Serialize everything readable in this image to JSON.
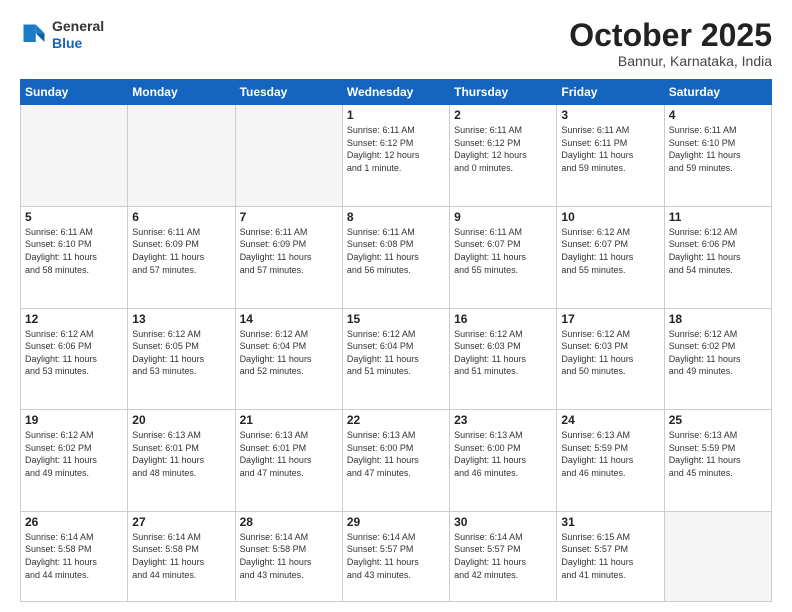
{
  "logo": {
    "line1": "General",
    "line2": "Blue"
  },
  "header": {
    "month": "October 2025",
    "location": "Bannur, Karnataka, India"
  },
  "days_of_week": [
    "Sunday",
    "Monday",
    "Tuesday",
    "Wednesday",
    "Thursday",
    "Friday",
    "Saturday"
  ],
  "weeks": [
    [
      {
        "day": "",
        "info": ""
      },
      {
        "day": "",
        "info": ""
      },
      {
        "day": "",
        "info": ""
      },
      {
        "day": "1",
        "info": "Sunrise: 6:11 AM\nSunset: 6:12 PM\nDaylight: 12 hours\nand 1 minute."
      },
      {
        "day": "2",
        "info": "Sunrise: 6:11 AM\nSunset: 6:12 PM\nDaylight: 12 hours\nand 0 minutes."
      },
      {
        "day": "3",
        "info": "Sunrise: 6:11 AM\nSunset: 6:11 PM\nDaylight: 11 hours\nand 59 minutes."
      },
      {
        "day": "4",
        "info": "Sunrise: 6:11 AM\nSunset: 6:10 PM\nDaylight: 11 hours\nand 59 minutes."
      }
    ],
    [
      {
        "day": "5",
        "info": "Sunrise: 6:11 AM\nSunset: 6:10 PM\nDaylight: 11 hours\nand 58 minutes."
      },
      {
        "day": "6",
        "info": "Sunrise: 6:11 AM\nSunset: 6:09 PM\nDaylight: 11 hours\nand 57 minutes."
      },
      {
        "day": "7",
        "info": "Sunrise: 6:11 AM\nSunset: 6:09 PM\nDaylight: 11 hours\nand 57 minutes."
      },
      {
        "day": "8",
        "info": "Sunrise: 6:11 AM\nSunset: 6:08 PM\nDaylight: 11 hours\nand 56 minutes."
      },
      {
        "day": "9",
        "info": "Sunrise: 6:11 AM\nSunset: 6:07 PM\nDaylight: 11 hours\nand 55 minutes."
      },
      {
        "day": "10",
        "info": "Sunrise: 6:12 AM\nSunset: 6:07 PM\nDaylight: 11 hours\nand 55 minutes."
      },
      {
        "day": "11",
        "info": "Sunrise: 6:12 AM\nSunset: 6:06 PM\nDaylight: 11 hours\nand 54 minutes."
      }
    ],
    [
      {
        "day": "12",
        "info": "Sunrise: 6:12 AM\nSunset: 6:06 PM\nDaylight: 11 hours\nand 53 minutes."
      },
      {
        "day": "13",
        "info": "Sunrise: 6:12 AM\nSunset: 6:05 PM\nDaylight: 11 hours\nand 53 minutes."
      },
      {
        "day": "14",
        "info": "Sunrise: 6:12 AM\nSunset: 6:04 PM\nDaylight: 11 hours\nand 52 minutes."
      },
      {
        "day": "15",
        "info": "Sunrise: 6:12 AM\nSunset: 6:04 PM\nDaylight: 11 hours\nand 51 minutes."
      },
      {
        "day": "16",
        "info": "Sunrise: 6:12 AM\nSunset: 6:03 PM\nDaylight: 11 hours\nand 51 minutes."
      },
      {
        "day": "17",
        "info": "Sunrise: 6:12 AM\nSunset: 6:03 PM\nDaylight: 11 hours\nand 50 minutes."
      },
      {
        "day": "18",
        "info": "Sunrise: 6:12 AM\nSunset: 6:02 PM\nDaylight: 11 hours\nand 49 minutes."
      }
    ],
    [
      {
        "day": "19",
        "info": "Sunrise: 6:12 AM\nSunset: 6:02 PM\nDaylight: 11 hours\nand 49 minutes."
      },
      {
        "day": "20",
        "info": "Sunrise: 6:13 AM\nSunset: 6:01 PM\nDaylight: 11 hours\nand 48 minutes."
      },
      {
        "day": "21",
        "info": "Sunrise: 6:13 AM\nSunset: 6:01 PM\nDaylight: 11 hours\nand 47 minutes."
      },
      {
        "day": "22",
        "info": "Sunrise: 6:13 AM\nSunset: 6:00 PM\nDaylight: 11 hours\nand 47 minutes."
      },
      {
        "day": "23",
        "info": "Sunrise: 6:13 AM\nSunset: 6:00 PM\nDaylight: 11 hours\nand 46 minutes."
      },
      {
        "day": "24",
        "info": "Sunrise: 6:13 AM\nSunset: 5:59 PM\nDaylight: 11 hours\nand 46 minutes."
      },
      {
        "day": "25",
        "info": "Sunrise: 6:13 AM\nSunset: 5:59 PM\nDaylight: 11 hours\nand 45 minutes."
      }
    ],
    [
      {
        "day": "26",
        "info": "Sunrise: 6:14 AM\nSunset: 5:58 PM\nDaylight: 11 hours\nand 44 minutes."
      },
      {
        "day": "27",
        "info": "Sunrise: 6:14 AM\nSunset: 5:58 PM\nDaylight: 11 hours\nand 44 minutes."
      },
      {
        "day": "28",
        "info": "Sunrise: 6:14 AM\nSunset: 5:58 PM\nDaylight: 11 hours\nand 43 minutes."
      },
      {
        "day": "29",
        "info": "Sunrise: 6:14 AM\nSunset: 5:57 PM\nDaylight: 11 hours\nand 43 minutes."
      },
      {
        "day": "30",
        "info": "Sunrise: 6:14 AM\nSunset: 5:57 PM\nDaylight: 11 hours\nand 42 minutes."
      },
      {
        "day": "31",
        "info": "Sunrise: 6:15 AM\nSunset: 5:57 PM\nDaylight: 11 hours\nand 41 minutes."
      },
      {
        "day": "",
        "info": ""
      }
    ]
  ]
}
